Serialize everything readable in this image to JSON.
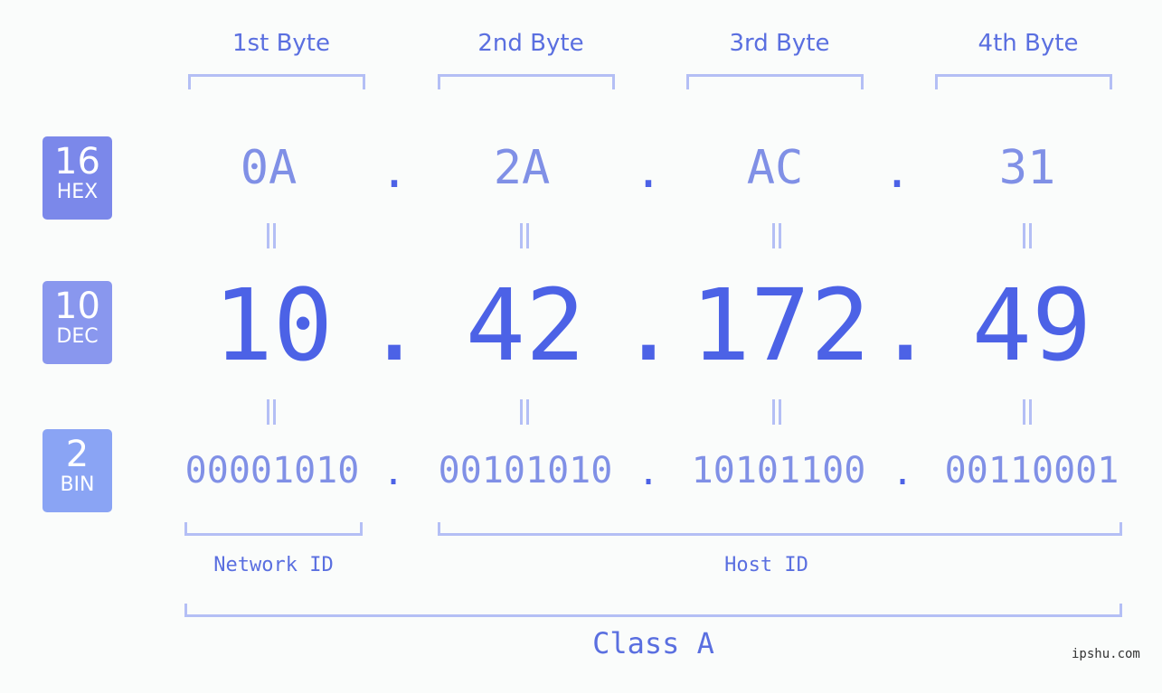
{
  "bytes": [
    {
      "label": "1st Byte",
      "hex": "0A",
      "dec": "10",
      "bin": "00001010"
    },
    {
      "label": "2nd Byte",
      "hex": "2A",
      "dec": "42",
      "bin": "00101010"
    },
    {
      "label": "3rd Byte",
      "hex": "AC",
      "dec": "172",
      "bin": "10101100"
    },
    {
      "label": "4th Byte",
      "hex": "31",
      "dec": "49",
      "bin": "00110001"
    }
  ],
  "separator": ".",
  "badges": {
    "hex": {
      "num": "16",
      "text": "HEX",
      "color": "#7b88ea"
    },
    "dec": {
      "num": "10",
      "text": "DEC",
      "color": "#8997ee"
    },
    "bin": {
      "num": "2",
      "text": "BIN",
      "color": "#8aa4f4"
    }
  },
  "segments": {
    "network": "Network ID",
    "host": "Host ID",
    "class": "Class A"
  },
  "watermark": "ipshu.com",
  "colors": {
    "primary": "#4c62e6",
    "secondary": "#8090e6",
    "bracket": "#b4bff5"
  }
}
